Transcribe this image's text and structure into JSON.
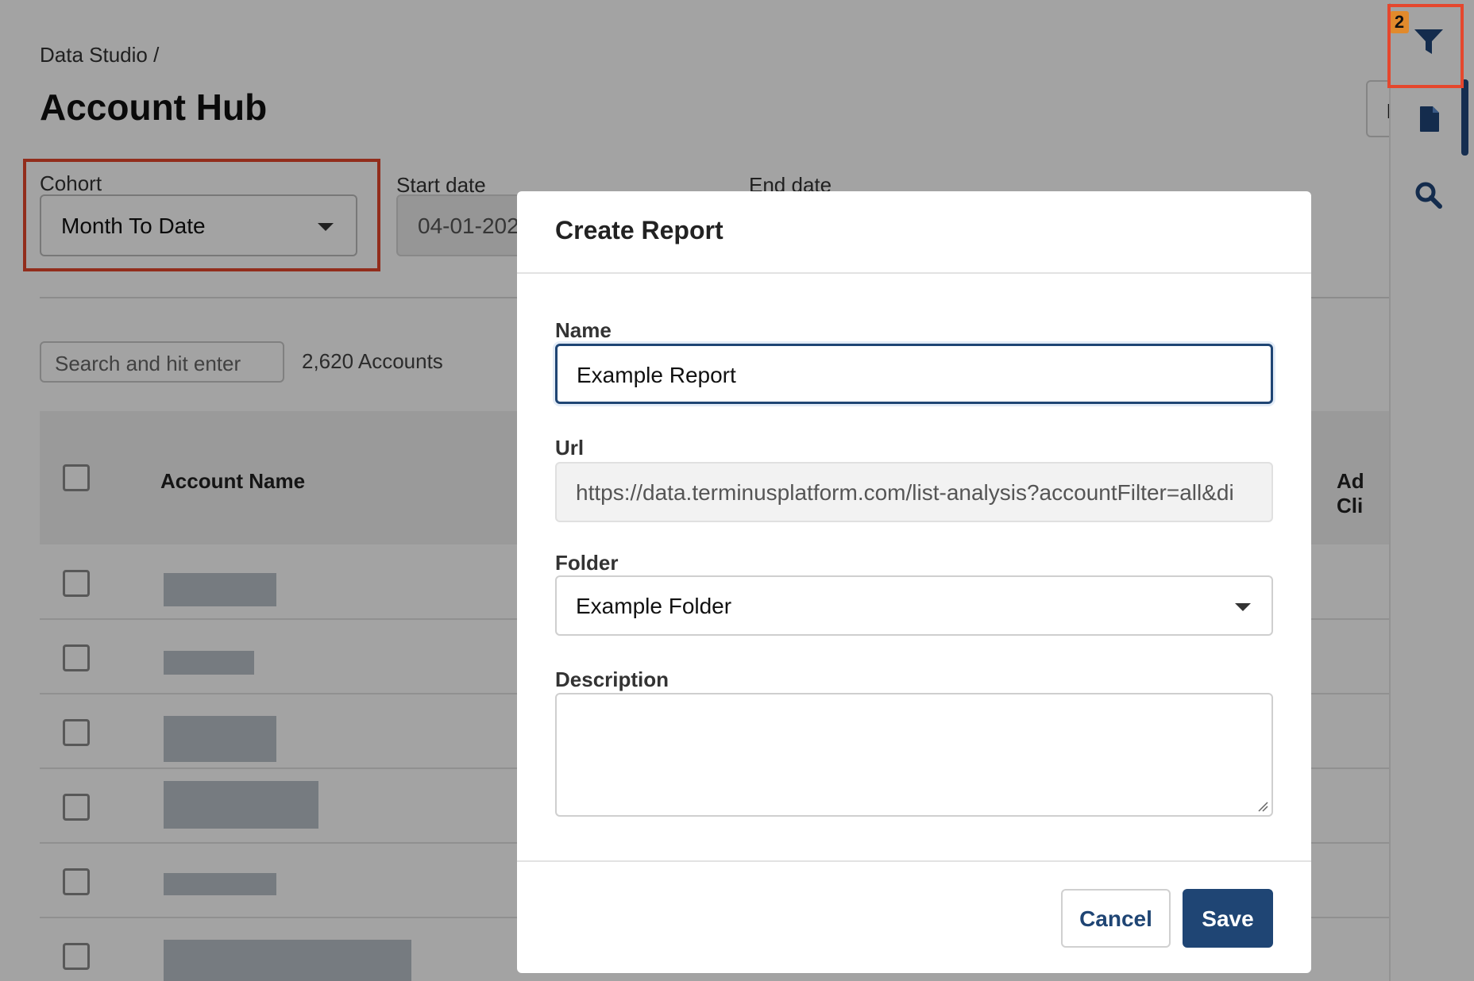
{
  "breadcrumb": "Data Studio /",
  "page_title": "Account Hub",
  "top_button_label": "N",
  "filters": {
    "cohort_label": "Cohort",
    "cohort_value": "Month To Date",
    "start_label": "Start date",
    "start_value": "04-01-202",
    "end_label": "End date"
  },
  "search": {
    "placeholder": "Search and hit enter",
    "count": "2,620 Accounts"
  },
  "table": {
    "columns": [
      "Account Name",
      "Ad Cli"
    ]
  },
  "sidebar": {
    "filter_badge": "2",
    "icons": [
      "filter-icon",
      "document-icon",
      "search-icon"
    ]
  },
  "modal": {
    "title": "Create Report",
    "name_label": "Name",
    "name_value": "Example Report",
    "url_label": "Url",
    "url_value": "https://data.terminusplatform.com/list-analysis?accountFilter=all&di",
    "folder_label": "Folder",
    "folder_value": "Example Folder",
    "description_label": "Description",
    "description_value": "",
    "cancel_label": "Cancel",
    "save_label": "Save"
  },
  "colors": {
    "accent": "#1f4574",
    "highlight": "#e5472d",
    "badge": "#e18a2c"
  }
}
